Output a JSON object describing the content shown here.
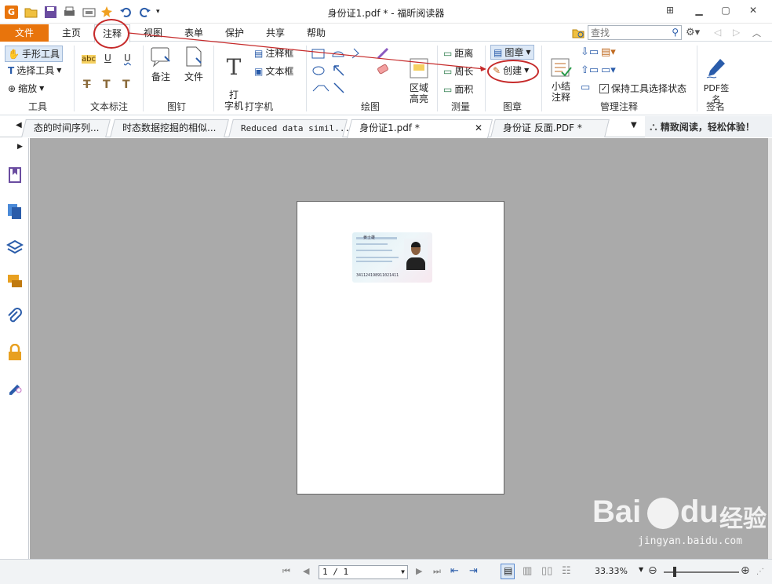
{
  "window": {
    "title": "身份证1.pdf * - 福昕阅读器",
    "controls": [
      "restore-down",
      "minimize",
      "maximize",
      "close"
    ]
  },
  "menu": {
    "items": [
      "文件",
      "主页",
      "注释",
      "视图",
      "表单",
      "保护",
      "共享",
      "帮助"
    ],
    "active": "注释"
  },
  "search": {
    "placeholder": "查找"
  },
  "ribbon": {
    "tools": {
      "hand": "手形工具",
      "select": "选择工具",
      "zoom": "缩放",
      "group": "工具"
    },
    "text_markup": {
      "group": "文本标注",
      "abc": "abc",
      "underline": "U",
      "squiggly": "U",
      "strike": "T",
      "replace": "T",
      "insert": "T"
    },
    "pin": {
      "note": "备注",
      "file": "文件",
      "group": "图钉"
    },
    "typewriter": {
      "big_label": "打\n字机",
      "callout": "注释框",
      "textbox": "文本框",
      "group": "打字机"
    },
    "drawing": {
      "group": "绘图"
    },
    "area_highlight": {
      "label": "区域\n高亮"
    },
    "measure": {
      "distance": "距离",
      "perimeter": "周长",
      "area": "面积",
      "group": "测量"
    },
    "stamp": {
      "stamp": "图章",
      "create": "创建",
      "group": "图章"
    },
    "manage": {
      "summarize": "小结\n注释",
      "keep_tool": "保持工具选择状态",
      "keep_tool_checked": true,
      "group": "管理注释"
    },
    "sign": {
      "label": "PDF签\n名",
      "group": "签名"
    }
  },
  "tabs": [
    {
      "label": "态的时间序列..."
    },
    {
      "label": "时态数据挖掘的相似..."
    },
    {
      "label": "Reduced data simil..."
    },
    {
      "label": "身份证1.pdf *",
      "active": true
    },
    {
      "label": "身份证 反面.PDF *"
    }
  ],
  "promo": "精致阅读，轻松体验！",
  "statusbar": {
    "page": "1 / 1",
    "zoom": "33.33%"
  },
  "idcard": {
    "name": "姜士雄",
    "number": "341124198911021411"
  },
  "watermark": {
    "brand": "Bai",
    "brand2": "du",
    "cn": "经验",
    "url": "jingyan.baidu.com"
  },
  "colors": {
    "accent": "#e8740c",
    "annotation": "#c62a2a",
    "doc_bg": "#aaaaaa"
  }
}
